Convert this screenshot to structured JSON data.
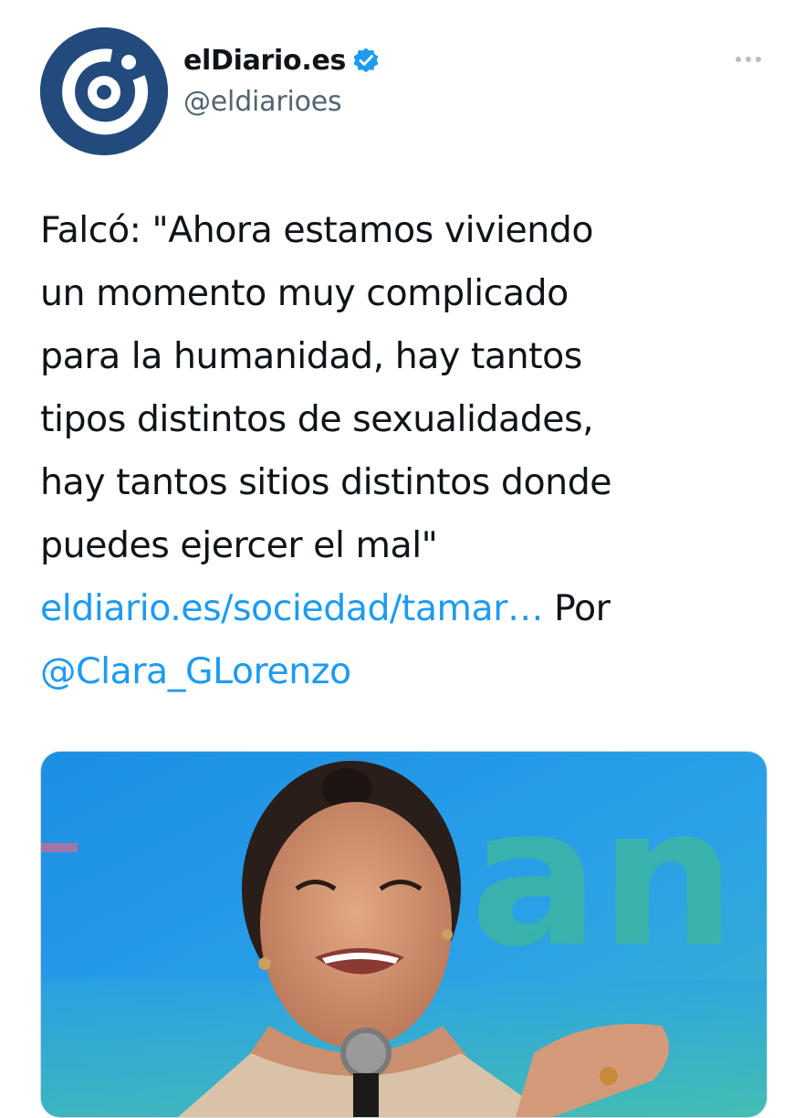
{
  "account": {
    "display_name": "elDiario.es",
    "handle": "@eldiarioes",
    "verified": true,
    "avatar_icon": "eldiario-logo-icon",
    "verified_icon": "verified-badge-icon",
    "more_icon": "more-options-icon"
  },
  "tweet": {
    "lines": [
      "Falcó: \"Ahora estamos viviendo",
      "un momento muy complicado",
      "para la humanidad, hay tantos",
      "tipos distintos de sexualidades,",
      "hay tantos sitios distintos donde",
      "puedes ejercer el mal\""
    ],
    "link_text": "eldiario.es/sociedad/tamar…",
    "by_text": "Por",
    "mention": "@Clara_GLorenzo"
  },
  "card": {
    "image_description_icon": "photo-icon"
  },
  "colors": {
    "brand_blue": "#224a7d",
    "link_blue": "#1d9bf0",
    "verified_blue": "#1d9bf0",
    "text": "#0f1419",
    "secondary_text": "#536471"
  }
}
